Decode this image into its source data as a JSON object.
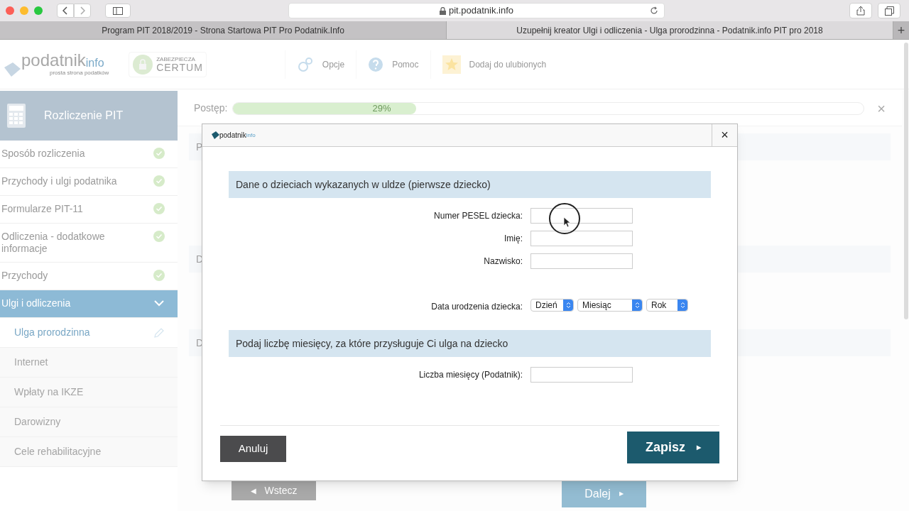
{
  "browser": {
    "address": "pit.podatnik.info",
    "tabs": [
      {
        "title": "Program PIT 2018/2019 - Strona Startowa PIT Pro Podatnik.Info",
        "selected": false
      },
      {
        "title": "Uzupełnij kreator Ulgi i odliczenia - Ulga prorodzinna - Podatnik.info PIT pro 2018",
        "selected": true
      }
    ],
    "new_tab": "+"
  },
  "header": {
    "logo": {
      "name": "podatnik",
      "suffix": "info",
      "tagline": "prosta strona podatków"
    },
    "badge": {
      "caption": "ZABEZPIECZA",
      "name": "CERTUM"
    },
    "nav": [
      {
        "kind": "options",
        "label": "Opcje"
      },
      {
        "kind": "help",
        "label": "Pomoc"
      },
      {
        "kind": "favorite",
        "label": "Dodaj do ulubionych"
      }
    ]
  },
  "sidebar": {
    "title": "Rozliczenie PIT",
    "items": [
      {
        "label": "Sposób rozliczenia",
        "done": true,
        "selected": false
      },
      {
        "label": "Przychody i ulgi podatnika",
        "done": true,
        "selected": false
      },
      {
        "label": "Formularze PIT-11",
        "done": true,
        "selected": false
      },
      {
        "label": "Odliczenia - dodatkowe informacje",
        "done": true,
        "selected": false
      },
      {
        "label": "Przychody",
        "done": true,
        "selected": false
      },
      {
        "label": "Ulgi i odliczenia",
        "done": false,
        "selected": true,
        "expanded": true,
        "children": [
          {
            "label": "Ulga prorodzinna",
            "selected": true
          },
          {
            "label": "Internet",
            "selected": false
          },
          {
            "label": "Wpłaty na IKZE",
            "selected": false
          },
          {
            "label": "Darowizny",
            "selected": false
          },
          {
            "label": "Cele rehabilitacyjne",
            "selected": false
          }
        ]
      }
    ]
  },
  "progress": {
    "label": "Postęp:",
    "level": 0.29,
    "reading": "29%",
    "close": "×"
  },
  "background_panels": [
    {
      "heading": "P"
    },
    {
      "heading": "D"
    },
    {
      "heading": "D"
    }
  ],
  "page_buttons": {
    "back_arrow": "◀",
    "back": "Wstecz",
    "next": "Dalej",
    "next_arrow": "▶"
  },
  "dialog": {
    "logo": {
      "name": "podatnik",
      "suffix": "info"
    },
    "close": "×",
    "sections": [
      {
        "title": "Dane o dzieciach wykazanych w uldze (pierwsze dziecko)",
        "fields": [
          {
            "kind": "text",
            "label": "Numer PESEL dziecka:"
          },
          {
            "kind": "text",
            "label": "Imię:"
          },
          {
            "kind": "text",
            "label": "Nazwisko:"
          },
          {
            "kind": "date",
            "label": "Data urodzenia dziecka:",
            "selects": [
              "Dzień",
              "Miesiąc",
              "Rok"
            ]
          }
        ]
      },
      {
        "title": "Podaj liczbę miesięcy, za które przysługuje Ci ulga na dziecko",
        "fields": [
          {
            "kind": "text",
            "label": "Liczba miesięcy (Podatnik):"
          }
        ]
      }
    ],
    "cancel": "Anuluj",
    "save": "Zapisz",
    "save_arrow": "▶"
  }
}
